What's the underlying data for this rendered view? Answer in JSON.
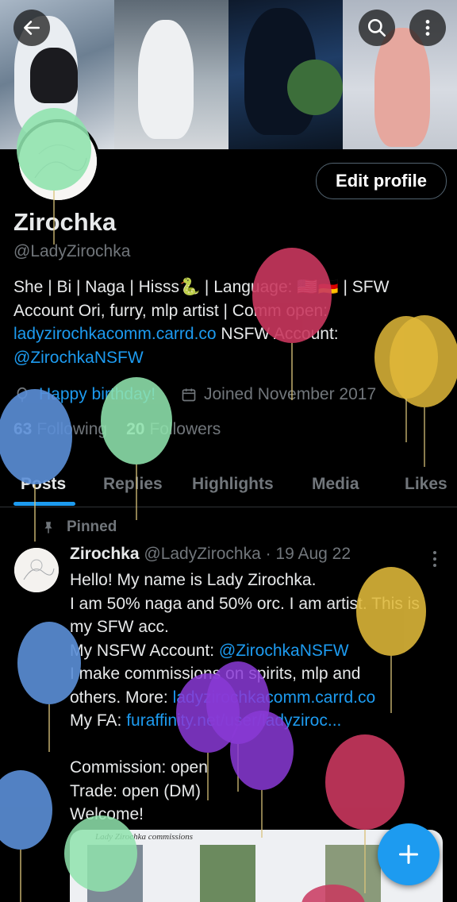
{
  "header": {
    "back_icon": "arrow-left-icon",
    "search_icon": "search-icon",
    "more_icon": "vertical-dots-icon"
  },
  "profile": {
    "name": "Zirochka",
    "handle": "@LadyZirochka",
    "edit_button": "Edit profile",
    "bio": {
      "line1_a": "She | Bi | Naga | Hisss🐍 | Language: 🇺🇸🇩🇪 | SFW",
      "line2": "Account Ori, furry, mlp artist | Comm open:",
      "line3_link": "ladyzirochkacomm.carrd.co",
      "line3_text": " NSFW Account:",
      "line4_link": "@ZirochkaNSFW"
    },
    "birthday": "Happy birthday!",
    "joined": "Joined November 2017",
    "following_count": "63",
    "following_label": "Following",
    "followers_count": "20",
    "followers_label": "Followers"
  },
  "tabs": {
    "posts": "Posts",
    "replies": "Replies",
    "highlights": "Highlights",
    "media": "Media",
    "likes": "Likes",
    "active": "Posts"
  },
  "pinned_post": {
    "pinned_label": "Pinned",
    "author": "Zirochka",
    "meta": "@LadyZirochka · 19 Aug 22",
    "lines": {
      "l1": "Hello! My name is Lady Zirochka.",
      "l2": "I am 50% naga and 50% orc. I am artist. This is",
      "l3": "my SFW acc.",
      "l4_text": "My NSFW Account: ",
      "l4_link": "@ZirochkaNSFW",
      "l5": "I make commissions on spirits, mlp and",
      "l6_text": "others. More: ",
      "l6_link": "ladyzirochkacomm.carrd.co",
      "l7_text": "My FA: ",
      "l7_link": "furaffinity.net/user/ladyziroc...",
      "l8": "Commission: open",
      "l9": "Trade: open (DM)",
      "l10": "Welcome!"
    },
    "media_caption": "Lady Zirochka commissions"
  },
  "fab": {
    "icon": "plus-icon",
    "label": "+"
  },
  "colors": {
    "accent": "#1d9bf0",
    "balloon_green": "#8fe3ad",
    "balloon_blue": "#5b8fd8",
    "balloon_red": "#c9375e",
    "balloon_yellow": "#e0b93a",
    "balloon_purple": "#8a3ad6"
  }
}
